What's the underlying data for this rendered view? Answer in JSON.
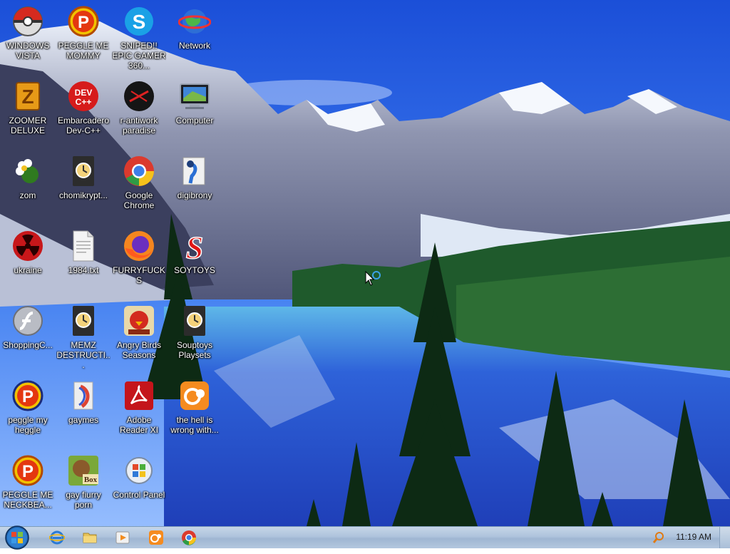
{
  "desktop": {
    "icons": [
      {
        "label": "WINDOWS VISTA",
        "icon": "pokeball-icon"
      },
      {
        "label": "PEGGLE ME MOMMY",
        "icon": "peggle-icon"
      },
      {
        "label": "SNIPED!! EPIC GAMER 360...",
        "icon": "skype-icon"
      },
      {
        "label": "Network",
        "icon": "network-globe-icon"
      },
      {
        "label": "ZOOMER DELUXE",
        "icon": "zoomer-icon"
      },
      {
        "label": "Embarcadero Dev-C++",
        "icon": "devcpp-icon"
      },
      {
        "label": "r-antiwork paradise",
        "icon": "antiwork-icon"
      },
      {
        "label": "Computer",
        "icon": "computer-icon"
      },
      {
        "label": "zom",
        "icon": "flower-icon"
      },
      {
        "label": "chomikrypt...",
        "icon": "shortcut-file-icon"
      },
      {
        "label": "Google Chrome",
        "icon": "chrome-icon"
      },
      {
        "label": "digibrony",
        "icon": "digibrony-icon"
      },
      {
        "label": "ukraine",
        "icon": "radiation-icon"
      },
      {
        "label": "1984.txt",
        "icon": "text-file-icon"
      },
      {
        "label": "FURRYFUCKS",
        "icon": "firefox-icon"
      },
      {
        "label": "SOYTOYS",
        "icon": "soytoys-icon"
      },
      {
        "label": "ShoppingC...",
        "icon": "flash-icon"
      },
      {
        "label": "MEMZ DESTRUCTI...",
        "icon": "shortcut-file-icon"
      },
      {
        "label": "Angry Birds Seasons",
        "icon": "angry-birds-icon"
      },
      {
        "label": "Souptoys Playsets",
        "icon": "shortcut-file-icon"
      },
      {
        "label": "peggle my heggle",
        "icon": "peggle-icon"
      },
      {
        "label": "gaymes",
        "icon": "media-file-icon"
      },
      {
        "label": "Adobe Reader XI",
        "icon": "adobe-reader-icon"
      },
      {
        "label": "the hell is wrong with...",
        "icon": "uc-browser-icon"
      },
      {
        "label": "PEGGLE ME NECKBEA...",
        "icon": "peggle-icon"
      },
      {
        "label": "gay fiurry porn",
        "icon": "box-game-icon"
      },
      {
        "label": "Control Panel",
        "icon": "control-panel-icon"
      }
    ]
  },
  "taskbar": {
    "start_label": "Start",
    "pinned": [
      {
        "name": "internet-explorer-icon"
      },
      {
        "name": "file-explorer-icon"
      },
      {
        "name": "media-player-icon"
      },
      {
        "name": "uc-browser-icon"
      },
      {
        "name": "chrome-icon"
      }
    ],
    "tray_icon": "search-icon",
    "clock": "11:19 AM"
  }
}
